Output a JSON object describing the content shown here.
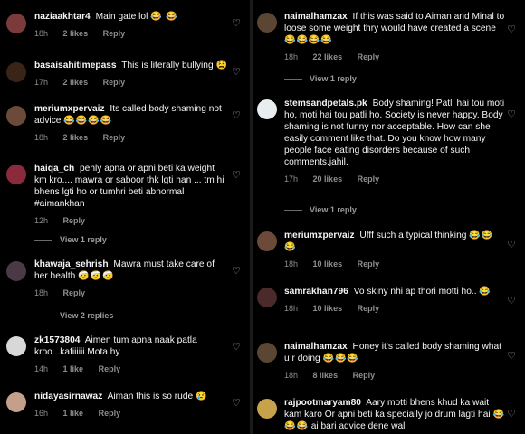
{
  "left": [
    {
      "id": "c1",
      "user": "naziaakhtar4",
      "text": "Main gate lol",
      "emoji": "😂 😂",
      "time": "18h",
      "likes": "2 likes",
      "reply": "Reply",
      "avatar_color": "#7b3b3b"
    },
    {
      "id": "c2",
      "user": "basaisahitimepass",
      "text": "This is literally bullying",
      "emoji": "😫",
      "time": "17h",
      "likes": "2 likes",
      "reply": "Reply",
      "avatar_color": "#3a2418"
    },
    {
      "id": "c3",
      "user": "meriumxpervaiz",
      "text": "Its called body shaming not advice",
      "emoji": "😂😂😂😂",
      "time": "18h",
      "likes": "2 likes",
      "reply": "Reply",
      "avatar_color": "#6b4a3a"
    },
    {
      "id": "c4",
      "user": "haiqa_ch",
      "text": "pehly apna or apni beti ka weight km kro.... mawra or saboor thk lgti han ... tm hi bhens lgti ho or tumhri beti abnormal #aimankhan",
      "emoji": "",
      "time": "12h",
      "likes": "",
      "reply": "Reply",
      "avatar_color": "#8a2a3a"
    },
    {
      "id": "c5",
      "user": "khawaja_sehrish",
      "text": "Mawra must take care of her health",
      "emoji": "🤕🤕🤕",
      "time": "18h",
      "likes": "",
      "reply": "Reply",
      "avatar_color": "#4a3a46"
    },
    {
      "id": "c6",
      "user": "zk1573804",
      "text": "Aimen tum apna naak patla kroo...kafiiiiii Mota hy",
      "emoji": "",
      "time": "14h",
      "likes": "1 like",
      "reply": "Reply",
      "avatar_color": "#d8d8d8"
    },
    {
      "id": "c7",
      "user": "nidayasirnawaz",
      "text": "Aiman this is so rude",
      "emoji": "😢",
      "time": "16h",
      "likes": "1 like",
      "reply": "Reply",
      "avatar_color": "#c4a08a"
    }
  ],
  "left_view_replies": [
    {
      "label": "View 1 reply"
    },
    {
      "label": "View 2 replies"
    }
  ],
  "right": [
    {
      "id": "r1",
      "user": "naimalhamzax",
      "text": "If this was said to Aiman and Minal to loose some weight thry would have created a scene",
      "emoji": "😂😂😂😂",
      "time": "18h",
      "likes": "22 likes",
      "reply": "Reply",
      "avatar_color": "#5a4632"
    },
    {
      "id": "r2",
      "user": "stemsandpetals.pk",
      "text": "Body shaming! Patli hai tou moti ho, moti hai tou patli ho. Society is never happy. Body shaming is not funny nor acceptable. How can she easily comment like that. Do you know how many people face eating disorders because of such comments.jahil.",
      "emoji": "",
      "time": "17h",
      "likes": "20 likes",
      "reply": "Reply",
      "avatar_color": "#e8eef0"
    },
    {
      "id": "r3",
      "user": "meriumxpervaiz",
      "text": "Ufff such a typical thinking",
      "emoji": "😂😂😂",
      "time": "18h",
      "likes": "10 likes",
      "reply": "Reply",
      "avatar_color": "#6b4a3a"
    },
    {
      "id": "r4",
      "user": "samrakhan796",
      "text": "Vo skiny nhi ap thori motti ho..",
      "emoji": "😂",
      "time": "18h",
      "likes": "10 likes",
      "reply": "Reply",
      "avatar_color": "#4a2a2a"
    },
    {
      "id": "r5",
      "user": "naimalhamzax",
      "text": "Honey it's called body shaming what u r doing",
      "emoji": "😂😂😂",
      "time": "18h",
      "likes": "8 likes",
      "reply": "Reply",
      "avatar_color": "#5a4632"
    },
    {
      "id": "r6",
      "user": "rajpootmaryam80",
      "text": "Aary motti bhens khud ka wait kam karo Or apni beti ka specially jo drum lagti hai",
      "emoji": "😂😂😂",
      "tail": "ai bari advice dene wali",
      "time": "",
      "likes": "",
      "reply": "",
      "avatar_color": "#c8a24a"
    }
  ],
  "right_view_replies": [
    {
      "label": "View 1 reply"
    },
    {
      "label": "View 1 reply"
    }
  ]
}
